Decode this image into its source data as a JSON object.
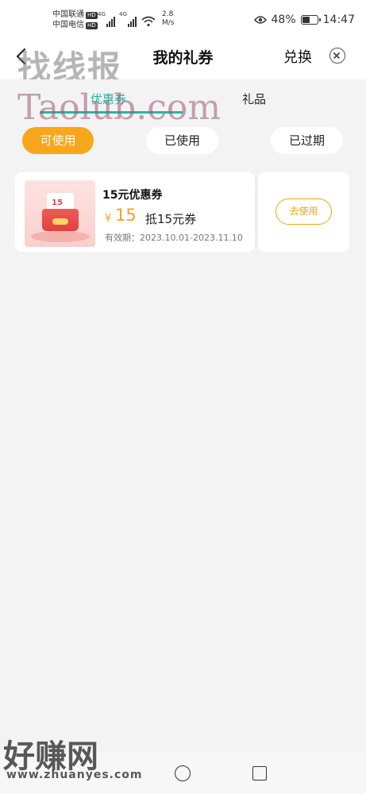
{
  "status_bar": {
    "carrier_1": "中国联通",
    "carrier_2": "中国电信",
    "hd_badge": "HD",
    "network_1": "4G",
    "network_2": "4G",
    "speed_value": "2.8",
    "speed_unit": "M/s",
    "battery": "48%",
    "time": "14:47"
  },
  "header": {
    "title": "我的礼券",
    "exchange_label": "兑换"
  },
  "tabs": [
    {
      "label": "优惠券",
      "active": true
    },
    {
      "label": "礼品",
      "active": false
    }
  ],
  "filters": [
    {
      "label": "可使用",
      "active": true
    },
    {
      "label": "已使用",
      "active": false
    },
    {
      "label": "已过期",
      "active": false
    }
  ],
  "coupon": {
    "name": "15元优惠券",
    "currency_symbol": "¥",
    "amount": "15",
    "description": "抵15元券",
    "validity": "有效期：2023.10.01-2023.11.10",
    "use_button": "去使用",
    "thumb_number": "15"
  },
  "watermarks": {
    "top_text": "找线报",
    "top_url": "Taolub.com",
    "bottom_text": "好赚网",
    "bottom_url": "www.zhuanyes.com"
  },
  "colors": {
    "accent_teal": "#26b5a8",
    "accent_orange": "#f8a61b",
    "background": "#f3f3f3"
  }
}
